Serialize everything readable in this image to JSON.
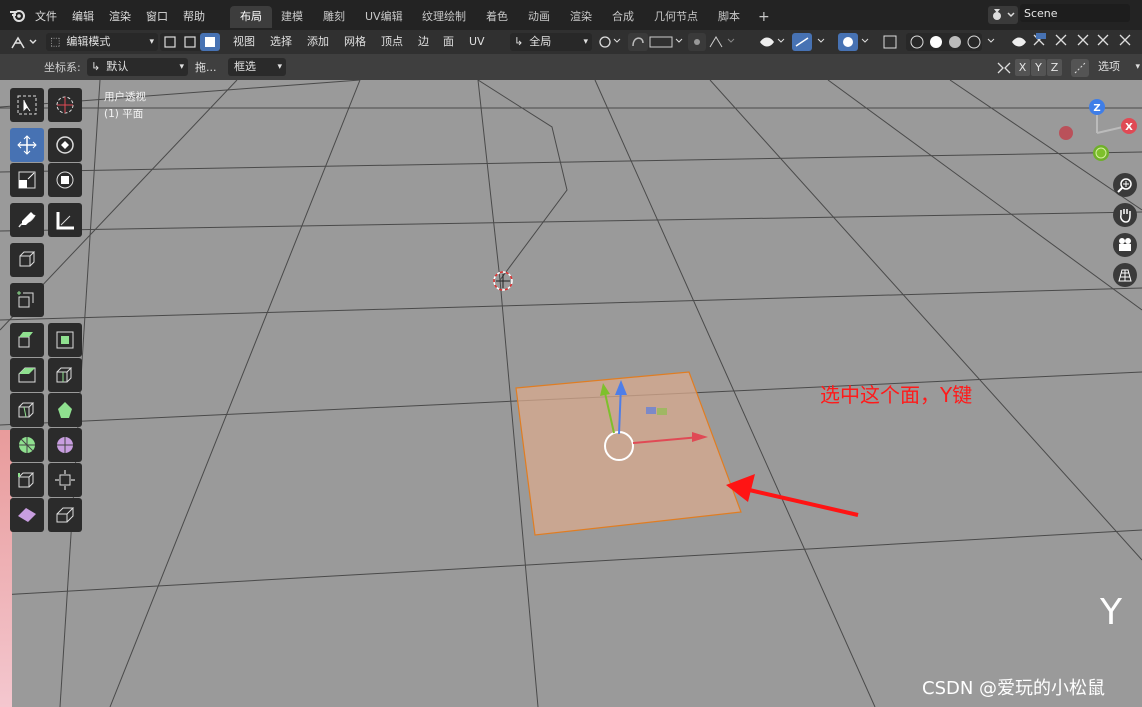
{
  "menu": {
    "file": "文件",
    "edit": "编辑",
    "render": "渲染",
    "window": "窗口",
    "help": "帮助"
  },
  "workspaces": [
    "布局",
    "建模",
    "雕刻",
    "UV编辑",
    "纹理绘制",
    "着色",
    "动画",
    "渲染",
    "合成",
    "几何节点",
    "脚本"
  ],
  "active_workspace": "布局",
  "scene": {
    "label": "Scene"
  },
  "header": {
    "mode": "编辑模式",
    "view": "视图",
    "select": "选择",
    "add": "添加",
    "mesh": "网格",
    "vertex": "顶点",
    "edge": "边",
    "face": "面",
    "uv": "UV",
    "orientation": "全局"
  },
  "header3": {
    "coord_label": "坐标系:",
    "coord_value": "默认",
    "drag_label": "拖...",
    "drag_value": "框选",
    "axis_x": "X",
    "axis_y": "Y",
    "axis_z": "Z",
    "options": "选项"
  },
  "viewport": {
    "view_name": "用户透视",
    "object": "(1) 平面",
    "annotation": "选中这个面，Y键",
    "key_label": "Y",
    "watermark": "CSDN @爱玩的小松鼠"
  },
  "gizmo": {
    "z": "Z",
    "x": "X"
  },
  "colors": {
    "selected_face": "#d8a98e",
    "annotation": "#ff1a1a",
    "active_tool": "#4772b3",
    "axis_x": "#e04a55",
    "axis_y": "#7ec02c",
    "axis_z": "#3f7ee8"
  }
}
